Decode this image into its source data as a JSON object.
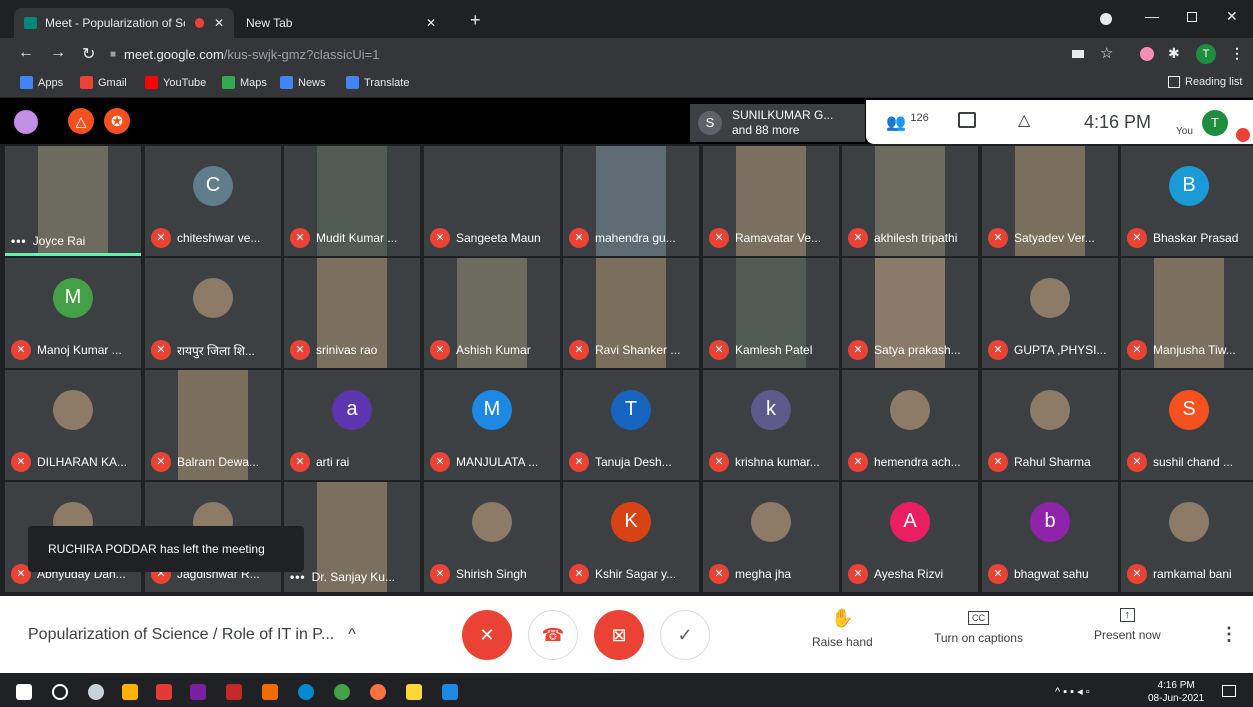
{
  "browser": {
    "tabs": [
      {
        "label": "Meet - Popularization of Scienc"
      },
      {
        "label": "New Tab"
      }
    ],
    "url_host": "meet.google.com",
    "url_path": "/kus-swjk-gmz?classicUi=1",
    "bookmarks": [
      {
        "label": "Apps",
        "color": "#4285f4"
      },
      {
        "label": "Gmail",
        "color": "#ea4335"
      },
      {
        "label": "YouTube",
        "color": "#ff0000"
      },
      {
        "label": "Maps",
        "color": "#34a853"
      },
      {
        "label": "News",
        "color": "#4285f4"
      },
      {
        "label": "Translate",
        "color": "#4285f4"
      }
    ],
    "reading_list": "Reading list",
    "profile_initial": "T"
  },
  "meet": {
    "presenter": {
      "initial": "S",
      "name": "SUNILKUMAR G...",
      "more": "and 88 more"
    },
    "participant_count": "126",
    "clock": "4:16 PM",
    "self_label": "You",
    "self_initial": "T",
    "meeting_title": "Popularization of Science / Role of IT in P...",
    "notification": "RUCHIRA PODDAR has left the meeting",
    "actions": {
      "raise_hand": "Raise hand",
      "captions": "Turn on captions",
      "present": "Present now"
    },
    "cc_icon_text": "CC",
    "accent": "#ea4335"
  },
  "participants": [
    {
      "name": "Joyce Rai",
      "kind": "video",
      "speaking": true
    },
    {
      "name": "chiteshwar ve...",
      "kind": "avatar",
      "initial": "C",
      "color": "#607d8b"
    },
    {
      "name": "Mudit Kumar ...",
      "kind": "video"
    },
    {
      "name": "Sangeeta Maun",
      "kind": "blank"
    },
    {
      "name": "mahendra gu...",
      "kind": "video"
    },
    {
      "name": "Ramavatar Ve...",
      "kind": "video"
    },
    {
      "name": "akhilesh tripathi",
      "kind": "video"
    },
    {
      "name": "Satyadev Ver...",
      "kind": "video"
    },
    {
      "name": "Bhaskar Prasad",
      "kind": "avatar",
      "initial": "B",
      "color": "#1a9bd7"
    },
    {
      "name": "Manoj Kumar ...",
      "kind": "avatar",
      "initial": "M",
      "color": "#43a047"
    },
    {
      "name": "रायपुर जिला शि...",
      "kind": "photo"
    },
    {
      "name": "srinivas rao",
      "kind": "video"
    },
    {
      "name": "Ashish Kumar",
      "kind": "video"
    },
    {
      "name": "Ravi Shanker ...",
      "kind": "video"
    },
    {
      "name": "Kamlesh Patel",
      "kind": "video"
    },
    {
      "name": "Satya prakash...",
      "kind": "video"
    },
    {
      "name": "GUPTA ,PHYSI...",
      "kind": "photo"
    },
    {
      "name": "Manjusha Tiw...",
      "kind": "video"
    },
    {
      "name": "DILHARAN KA...",
      "kind": "photo"
    },
    {
      "name": "Balram Dewa...",
      "kind": "video"
    },
    {
      "name": "arti rai",
      "kind": "avatar",
      "initial": "a",
      "color": "#5e35b1"
    },
    {
      "name": "MANJULATA ...",
      "kind": "avatar",
      "initial": "M",
      "color": "#1e88e5"
    },
    {
      "name": "Tanuja Desh...",
      "kind": "avatar",
      "initial": "T",
      "color": "#1565c0"
    },
    {
      "name": "krishna kumar...",
      "kind": "avatar",
      "initial": "k",
      "color": "#5c5a8a"
    },
    {
      "name": "hemendra ach...",
      "kind": "photo"
    },
    {
      "name": "Rahul Sharma",
      "kind": "photo"
    },
    {
      "name": "sushil chand ...",
      "kind": "avatar",
      "initial": "S",
      "color": "#f4511e"
    },
    {
      "name": "Abhyuday Dan...",
      "kind": "photo"
    },
    {
      "name": "Jagdishwar R...",
      "kind": "photo"
    },
    {
      "name": "Dr. Sanjay Ku...",
      "kind": "video",
      "speaking": true
    },
    {
      "name": "Shirish Singh",
      "kind": "photo"
    },
    {
      "name": "Kshir Sagar y...",
      "kind": "avatar",
      "initial": "K",
      "color": "#d84315"
    },
    {
      "name": "megha jha",
      "kind": "photo"
    },
    {
      "name": "Ayesha Rizvi",
      "kind": "avatar",
      "initial": "A",
      "color": "#e91e63"
    },
    {
      "name": "bhagwat sahu",
      "kind": "avatar",
      "initial": "b",
      "color": "#8e24aa"
    },
    {
      "name": "ramkamal bani",
      "kind": "photo"
    }
  ],
  "taskbar": {
    "time": "4:16 PM",
    "date": "08-Jun-2021"
  }
}
